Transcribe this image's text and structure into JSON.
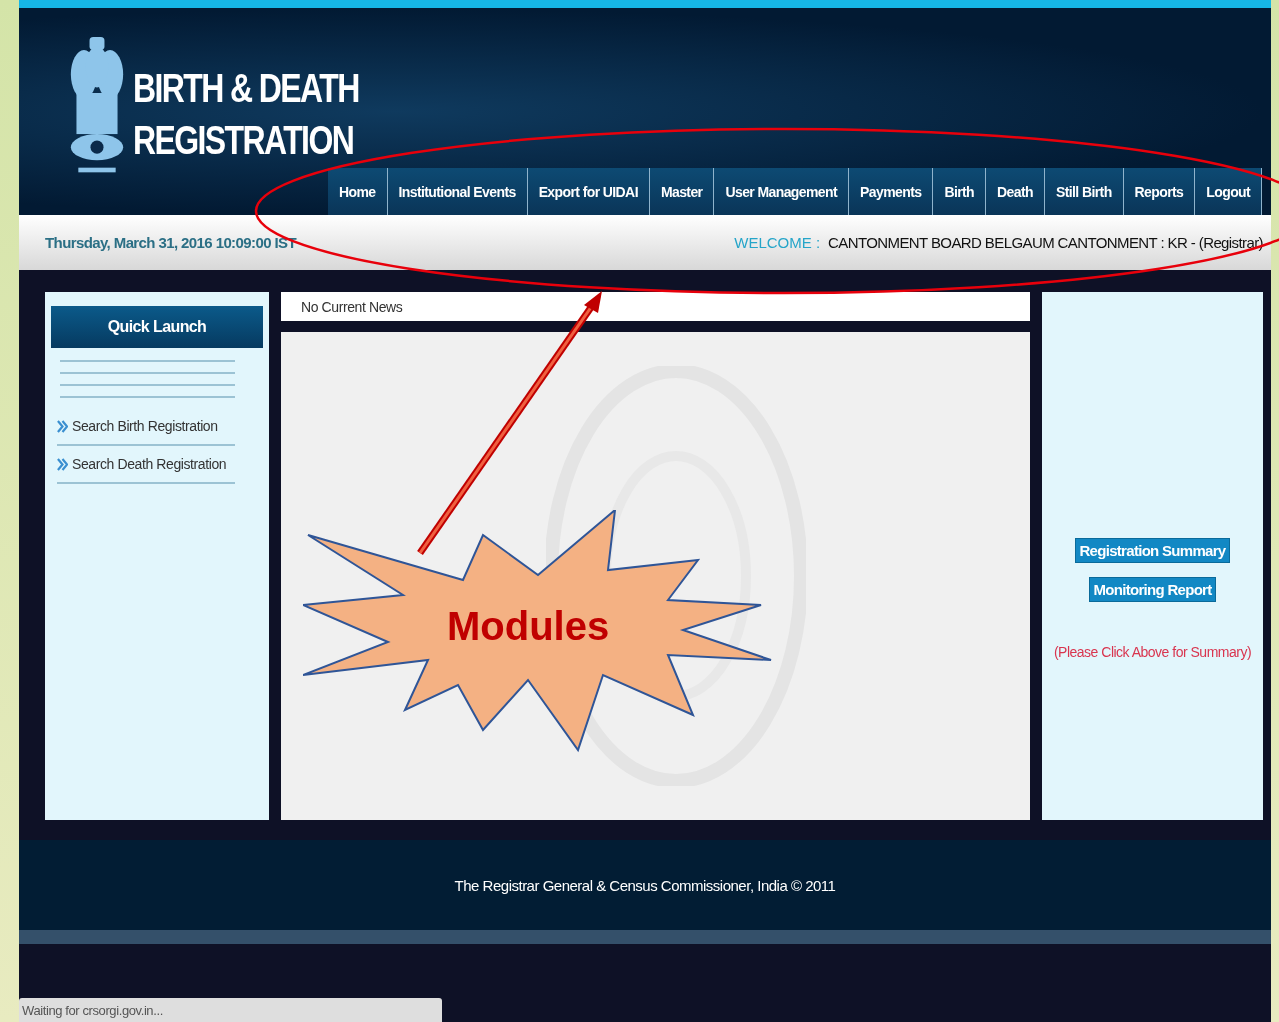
{
  "header": {
    "title_line_1": "BIRTH & DEATH",
    "title_line_2": "REGISTRATION"
  },
  "nav": [
    {
      "label": "Home"
    },
    {
      "label": "Institutional Events"
    },
    {
      "label": "Export for UIDAI"
    },
    {
      "label": "Master"
    },
    {
      "label": "User Management"
    },
    {
      "label": "Payments"
    },
    {
      "label": "Birth"
    },
    {
      "label": "Death"
    },
    {
      "label": "Still Birth"
    },
    {
      "label": "Reports"
    },
    {
      "label": "Logout"
    }
  ],
  "info_bar": {
    "datetime": "Thursday, March 31, 2016 10:09:00 IST",
    "welcome_label": "WELCOME :",
    "user": "CANTONMENT BOARD BELGAUM CANTONMENT : KR -  (Registrar)"
  },
  "quick_launch": {
    "title": "Quick Launch",
    "items": [
      "Search Birth Registration",
      "Search Death Registration"
    ]
  },
  "news": "No Current News",
  "summary_panel": {
    "buttons": [
      "Registration Summary",
      "Monitoring Report"
    ],
    "hint": "(Please Click Above for Summary)"
  },
  "footer": "The Registrar General & Census Commissioner, India © 2011",
  "status_bar": "Waiting for crsorgi.gov.in...",
  "annotation": {
    "callout": "Modules"
  }
}
